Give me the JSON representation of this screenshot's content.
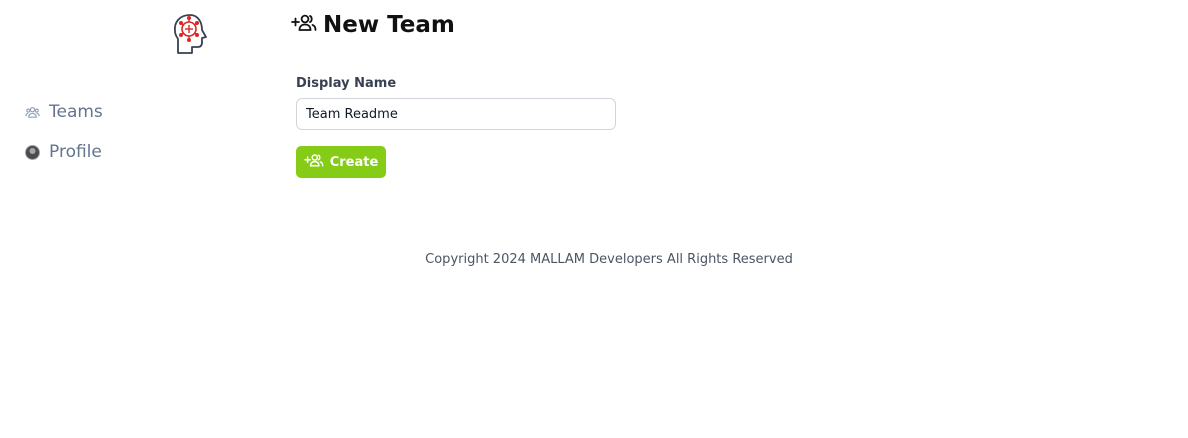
{
  "app": {
    "logo_icon": "brain-head-icon",
    "brand_color": "#dc2626"
  },
  "sidebar": {
    "items": [
      {
        "label": "Teams",
        "icon": "users-icon"
      },
      {
        "label": "Profile",
        "icon": "avatar"
      }
    ]
  },
  "page": {
    "title": "New Team",
    "title_icon": "user-add-icon"
  },
  "form": {
    "display_name_label": "Display Name",
    "display_name_value": "Team Readme",
    "create_label": "Create",
    "accent": "#84cc16"
  },
  "footer": {
    "copyright": "Copyright 2024 MALLAM Developers All Rights Reserved"
  }
}
